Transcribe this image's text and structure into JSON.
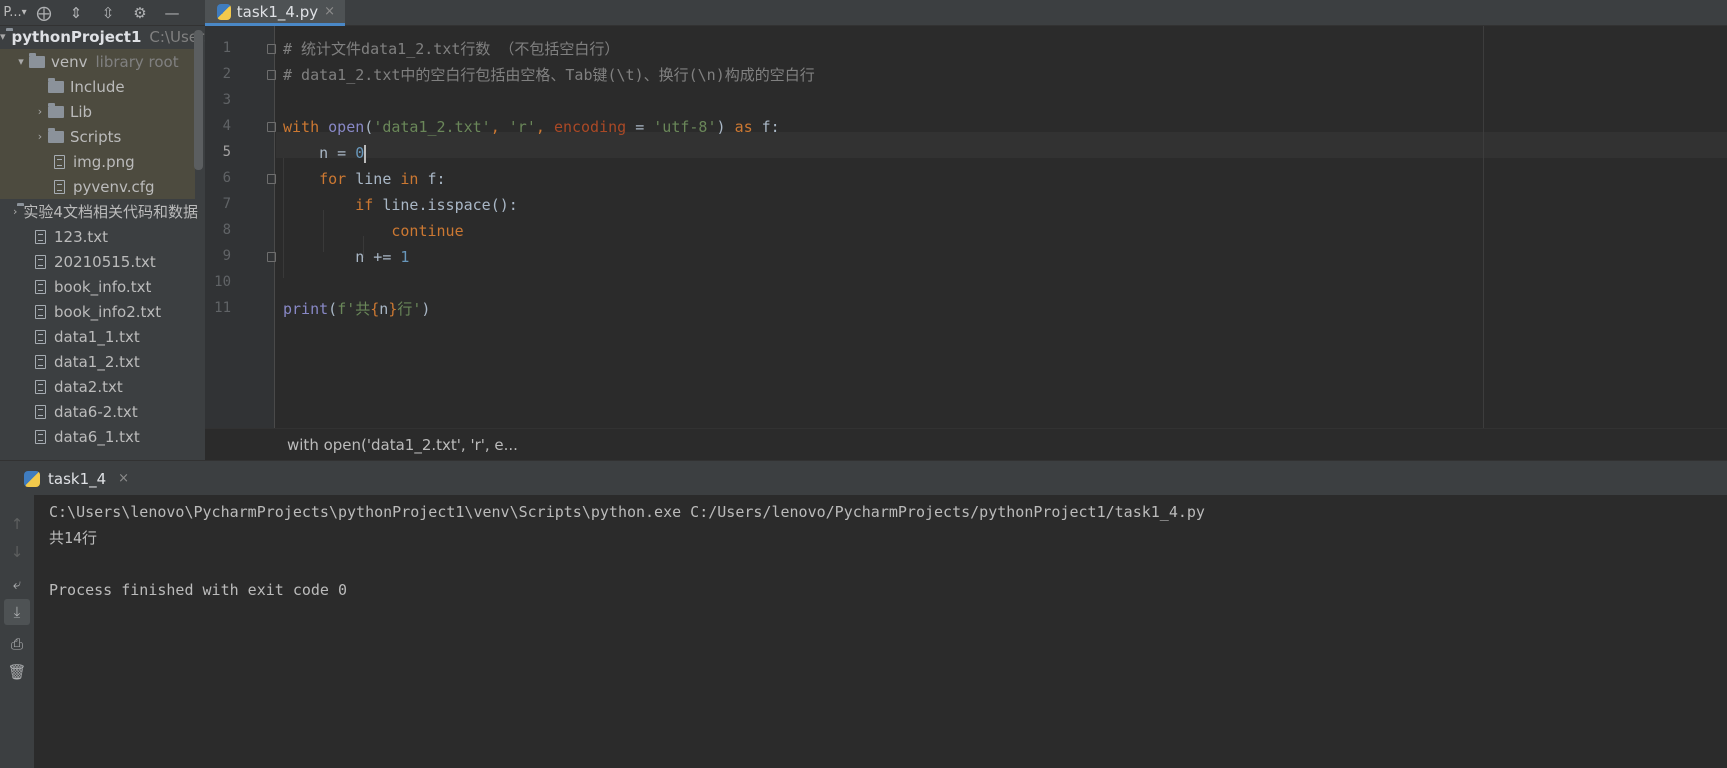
{
  "toolbar": {
    "project_dropdown": "P...",
    "icons": [
      "dropdown-icon",
      "locate-icon",
      "expand-all-icon",
      "collapse-all-icon",
      "gear-icon",
      "minimize-icon"
    ]
  },
  "editor_tab": {
    "label": "task1_4.py",
    "close": "×"
  },
  "project_tree": [
    {
      "label": "pythonProject1",
      "hint": "C:\\Users\\",
      "type": "folder",
      "arrow": "▾",
      "bold": true
    },
    {
      "label": "venv",
      "hint": "library root",
      "type": "folder",
      "arrow": "▾"
    },
    {
      "label": "Include",
      "type": "folder",
      "arrow": ""
    },
    {
      "label": "Lib",
      "type": "folder",
      "arrow": "›"
    },
    {
      "label": "Scripts",
      "type": "folder",
      "arrow": "›"
    },
    {
      "label": "img.png",
      "type": "file"
    },
    {
      "label": "pyvenv.cfg",
      "type": "file"
    },
    {
      "label": "实验4文档相关代码和数据",
      "type": "folder",
      "arrow": "›"
    },
    {
      "label": "123.txt",
      "type": "file"
    },
    {
      "label": "20210515.txt",
      "type": "file"
    },
    {
      "label": "book_info.txt",
      "type": "file"
    },
    {
      "label": "book_info2.txt",
      "type": "file"
    },
    {
      "label": "data1_1.txt",
      "type": "file"
    },
    {
      "label": "data1_2.txt",
      "type": "file"
    },
    {
      "label": "data2.txt",
      "type": "file"
    },
    {
      "label": "data6-2.txt",
      "type": "file"
    },
    {
      "label": "data6_1.txt",
      "type": "file"
    }
  ],
  "code": {
    "line_numbers": [
      "1",
      "2",
      "3",
      "4",
      "5",
      "6",
      "7",
      "8",
      "9",
      "10",
      "11"
    ],
    "current_line": "5",
    "l1": "# 统计文件data1_2.txt行数 （不包括空白行）",
    "l2": "# data1_2.txt中的空白行包括由空格、Tab键(\\t)、换行(\\n)构成的空白行",
    "l4": {
      "with": "with",
      "sp1": " ",
      "open": "open",
      "p1": "(",
      "s1": "'data1_2.txt'",
      "c1": ", ",
      "s2": "'r'",
      "c2": ", ",
      "param": "encoding",
      "eq": " = ",
      "s3": "'utf-8'",
      "p2": ") ",
      "as": "as",
      "rest": " f:"
    },
    "l5": {
      "indent": "    ",
      "text": "n = ",
      "num": "0"
    },
    "l6": {
      "indent": "    ",
      "for": "for",
      "mid": " line ",
      "in": "in",
      "rest": " f:"
    },
    "l7": {
      "indent": "        ",
      "if": "if",
      "rest": " line.isspace():"
    },
    "l8": {
      "indent": "            ",
      "kw": "continue"
    },
    "l9": {
      "indent": "        ",
      "text": "n += ",
      "num": "1"
    },
    "l11": {
      "fn": "print",
      "p1": "(",
      "str1": "f'共",
      "brace1": "{",
      "var": "n",
      "brace2": "}",
      "str2": "行'",
      "p2": ")"
    }
  },
  "breadcrumb": "with open('data1_2.txt', 'r', e...",
  "run_panel": {
    "tab_label": "task1_4",
    "close": "×",
    "side_icons": [
      "arrow-up-icon",
      "arrow-down-icon",
      "soft-wrap-icon",
      "scroll-to-end-icon",
      "print-icon",
      "trash-icon"
    ],
    "side_glyphs": [
      "↑",
      "↓",
      "⤶",
      "⤓",
      "⎙",
      "🗑"
    ],
    "console_lines": [
      "C:\\Users\\lenovo\\PycharmProjects\\pythonProject1\\venv\\Scripts\\python.exe C:/Users/lenovo/PycharmProjects/pythonProject1/task1_4.py",
      "共14行",
      "",
      "Process finished with exit code 0"
    ]
  },
  "colors": {
    "keyword": "#cc7832",
    "string": "#6a8759",
    "number": "#6897bb",
    "comment": "#808080",
    "builtin": "#8888c6",
    "param": "#aa4926",
    "accent": "#4a88c7"
  }
}
